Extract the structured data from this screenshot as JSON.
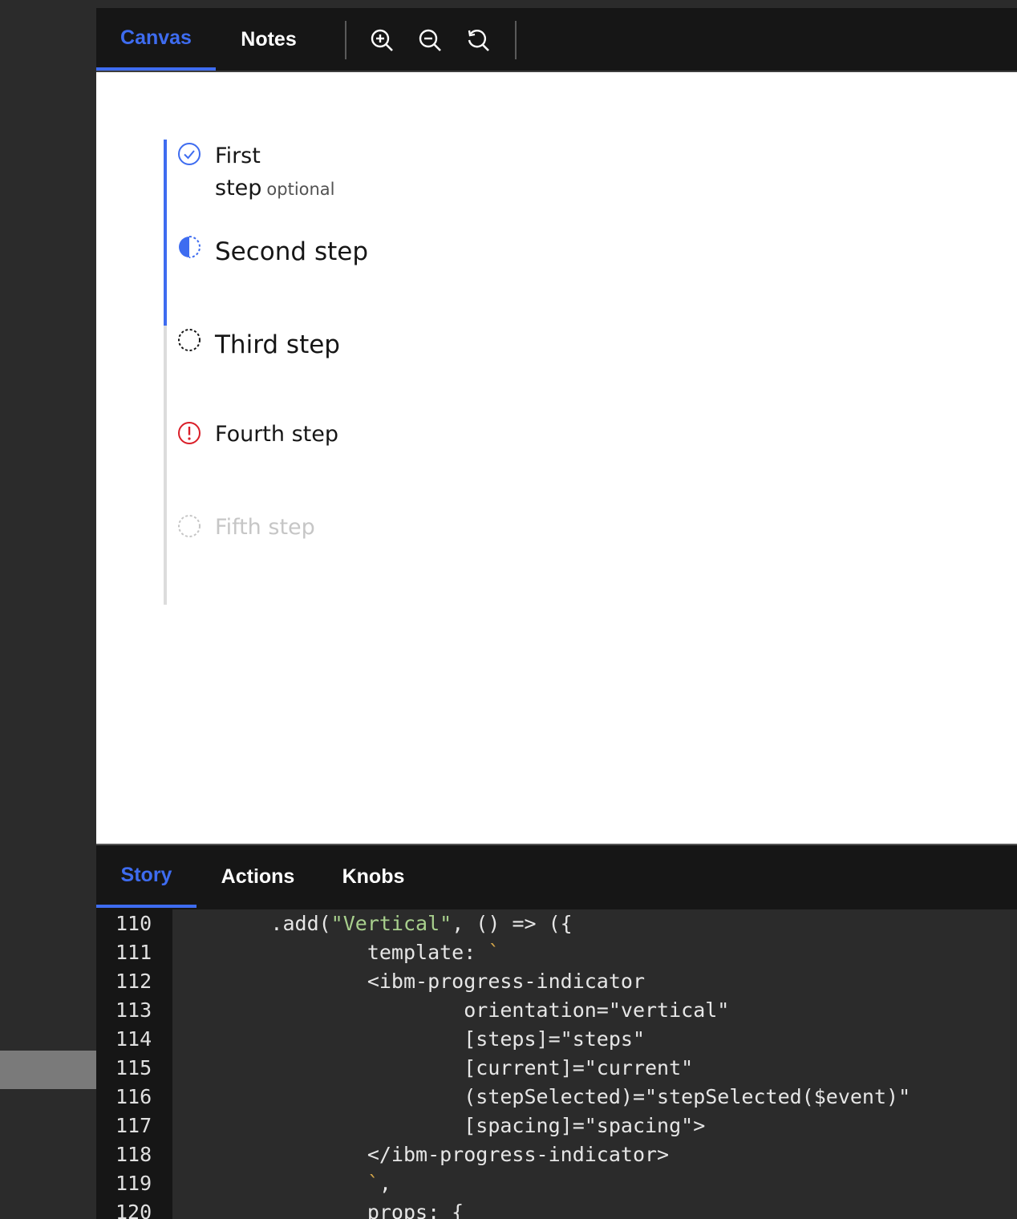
{
  "toolbar": {
    "tabs": [
      {
        "label": "Canvas",
        "active": true
      },
      {
        "label": "Notes",
        "active": false
      }
    ],
    "tools": [
      {
        "icon": "zoom-in-icon"
      },
      {
        "icon": "zoom-out-icon"
      },
      {
        "icon": "reset-zoom-icon"
      }
    ]
  },
  "progress": {
    "orientation": "vertical",
    "steps": [
      {
        "label_line1": "First",
        "label_line2": "step",
        "secondary": "optional",
        "state": "complete"
      },
      {
        "label": "Second step",
        "state": "current"
      },
      {
        "label": "Third step",
        "state": "incomplete"
      },
      {
        "label": "Fourth step",
        "state": "error"
      },
      {
        "label": "Fifth step",
        "state": "disabled"
      }
    ]
  },
  "addons": {
    "tabs": [
      {
        "label": "Story",
        "active": true
      },
      {
        "label": "Actions",
        "active": false
      },
      {
        "label": "Knobs",
        "active": false
      }
    ]
  },
  "code": {
    "lines": [
      {
        "n": "110",
        "pre": "        .add(",
        "str": "\"Vertical\"",
        "post": ", () => ({"
      },
      {
        "n": "111",
        "pre": "                template: ",
        "tick": "`",
        "post": ""
      },
      {
        "n": "112",
        "pre": "                <ibm-progress-indicator"
      },
      {
        "n": "113",
        "pre": "                        orientation=\"vertical\""
      },
      {
        "n": "114",
        "pre": "                        [steps]=\"steps\""
      },
      {
        "n": "115",
        "pre": "                        [current]=\"current\""
      },
      {
        "n": "116",
        "pre": "                        (stepSelected)=\"stepSelected($event)\""
      },
      {
        "n": "117",
        "pre": "                        [spacing]=\"spacing\">"
      },
      {
        "n": "118",
        "pre": "                </ibm-progress-indicator>"
      },
      {
        "n": "119",
        "pre": "                ",
        "tick": "`",
        "post": ","
      },
      {
        "n": "120",
        "pre": "                props: {"
      }
    ]
  },
  "colors": {
    "accent": "#3e6cf0",
    "error": "#da1e28",
    "disabled": "#c6c6c6",
    "string": "#a8d08d"
  }
}
